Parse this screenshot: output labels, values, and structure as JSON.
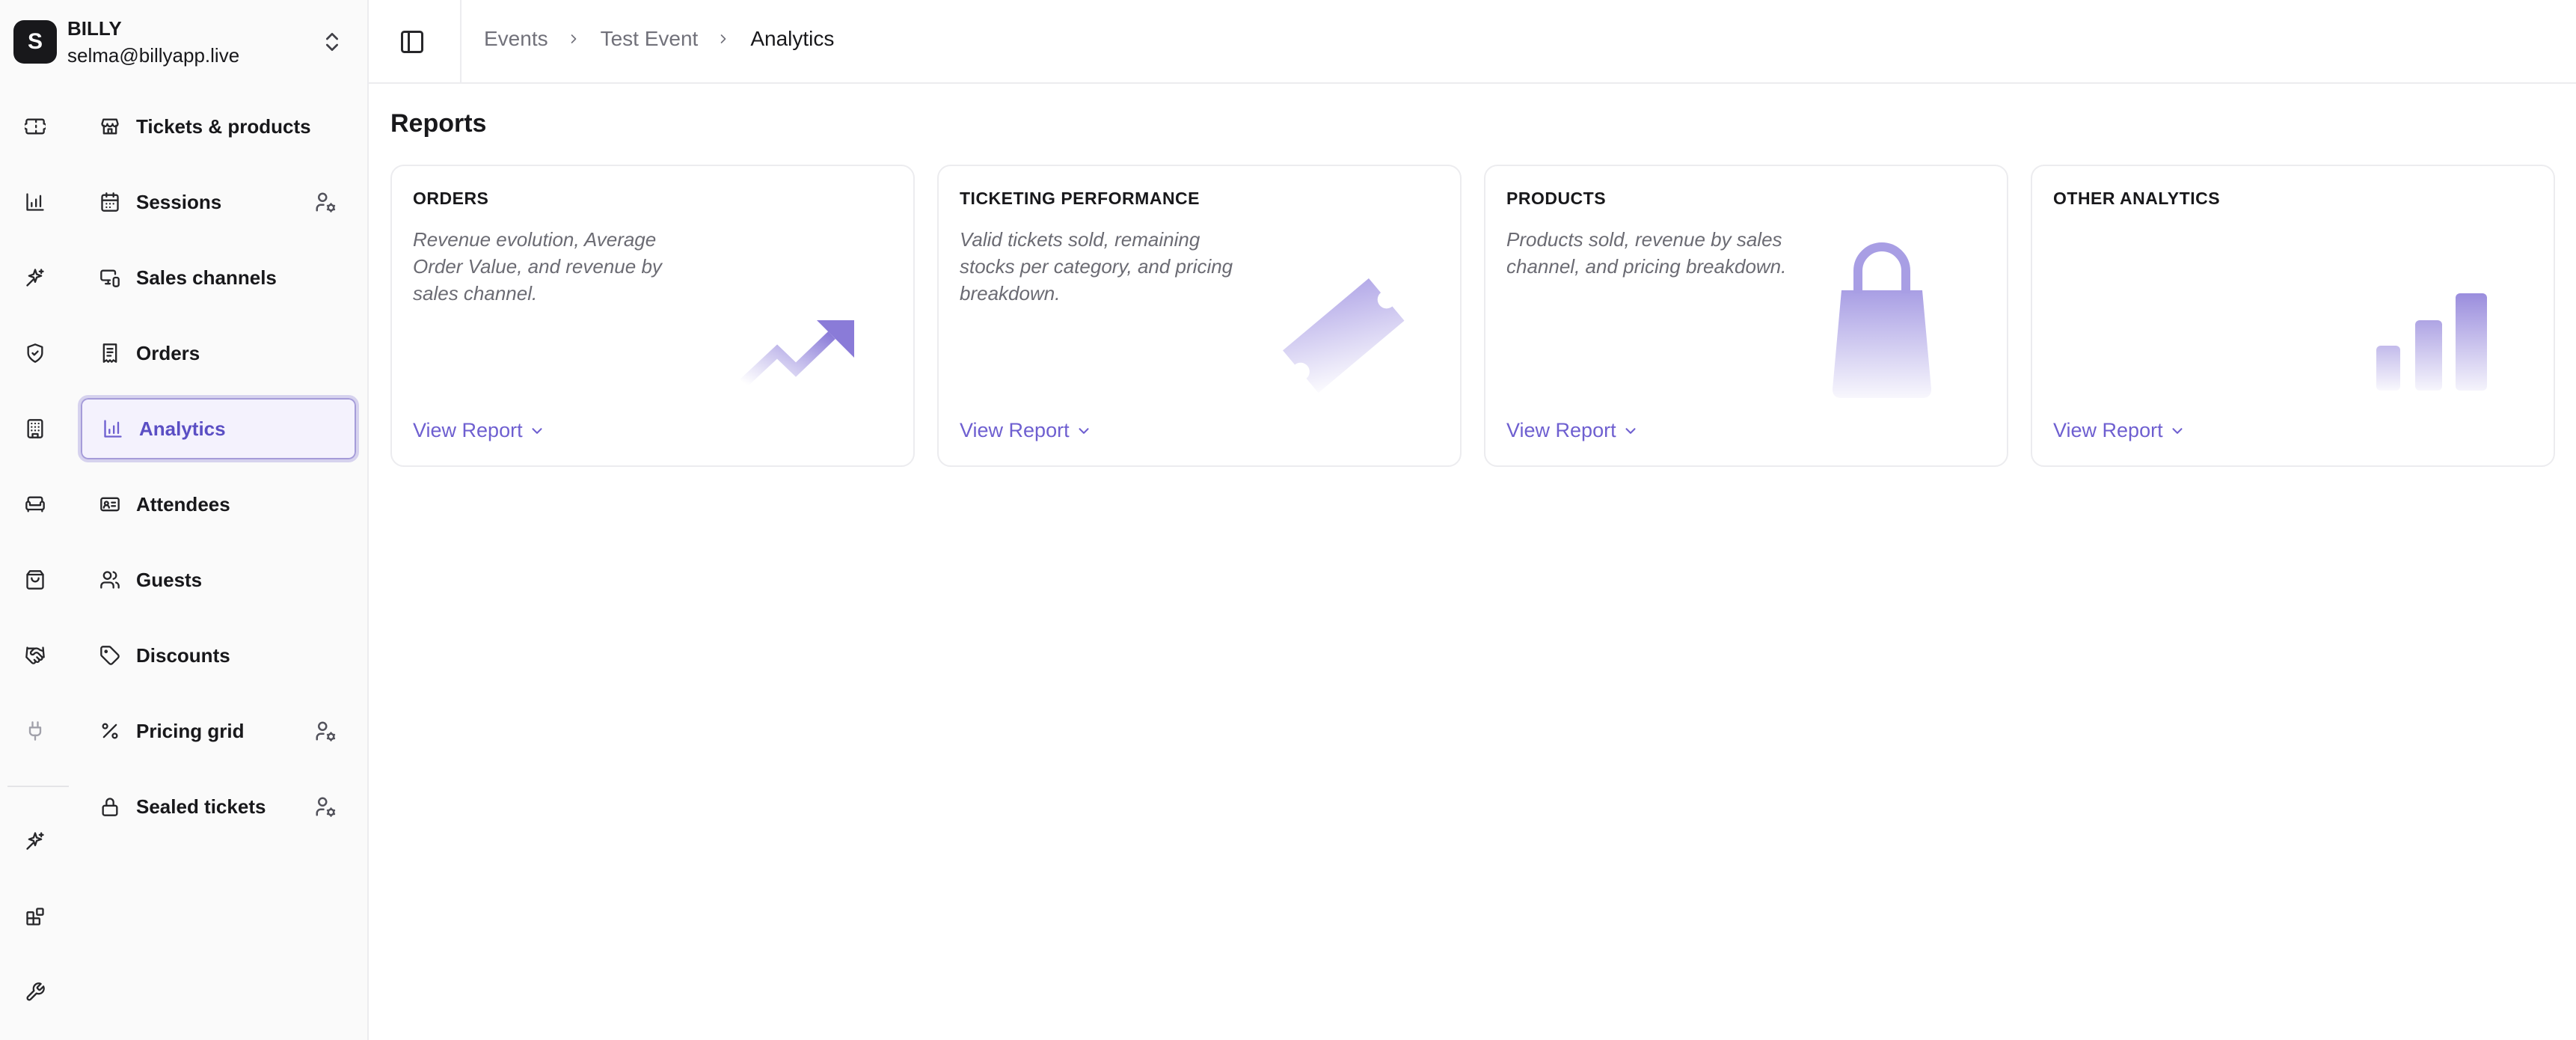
{
  "account": {
    "initial": "S",
    "name": "BILLY",
    "email": "selma@billyapp.live"
  },
  "rail": {
    "icons": [
      "ticket-icon",
      "bar-chart-icon",
      "sparkles-icon",
      "shield-check-icon",
      "building-icon",
      "sofa-icon",
      "shopping-bag-icon",
      "handshake-icon",
      "plug-icon",
      "sparkles-icon",
      "blocks-icon",
      "wrench-icon"
    ]
  },
  "nav": {
    "items": [
      {
        "label": "Tickets & products",
        "icon": "store-icon",
        "admin": false
      },
      {
        "label": "Sessions",
        "icon": "calendar-icon",
        "admin": true
      },
      {
        "label": "Sales channels",
        "icon": "devices-icon",
        "admin": false
      },
      {
        "label": "Orders",
        "icon": "receipt-icon",
        "admin": false
      },
      {
        "label": "Analytics",
        "icon": "bar-chart-icon",
        "admin": false,
        "active": true
      },
      {
        "label": "Attendees",
        "icon": "id-card-icon",
        "admin": false
      },
      {
        "label": "Guests",
        "icon": "users-icon",
        "admin": false
      },
      {
        "label": "Discounts",
        "icon": "tag-icon",
        "admin": false
      },
      {
        "label": "Pricing grid",
        "icon": "percent-icon",
        "admin": true
      },
      {
        "label": "Sealed tickets",
        "icon": "lock-icon",
        "admin": true
      }
    ]
  },
  "breadcrumb": {
    "items": [
      "Events",
      "Test Event",
      "Analytics"
    ]
  },
  "main": {
    "title": "Reports",
    "cards": [
      {
        "title": "ORDERS",
        "description": "Revenue evolution, Average Order Value, and revenue by sales channel.",
        "link": "View Report",
        "art": "trend-arrow-icon"
      },
      {
        "title": "TICKETING PERFORMANCE",
        "description": "Valid tickets sold, remaining stocks per category, and pricing breakdown.",
        "link": "View Report",
        "art": "ticket-icon"
      },
      {
        "title": "PRODUCTS",
        "description": "Products sold, revenue by sales channel, and pricing breakdown.",
        "link": "View Report",
        "art": "shopping-bag-icon"
      },
      {
        "title": "OTHER ANALYTICS",
        "description": "",
        "link": "View Report",
        "art": "bar-chart-icon"
      }
    ]
  },
  "colors": {
    "accent": "#6e5fd0",
    "active_bg": "#f4f2fd",
    "sidebar_bg": "#fafafa",
    "border": "#ececef"
  }
}
